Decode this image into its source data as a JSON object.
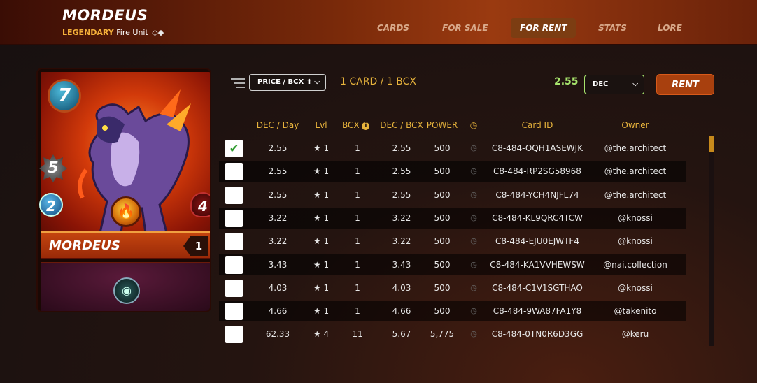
{
  "header": {
    "title": "MORDEUS",
    "rarity": "LEGENDARY",
    "unit_type": "Fire Unit",
    "nav": [
      "CARDS",
      "FOR SALE",
      "FOR RENT",
      "STATS",
      "LORE"
    ],
    "active_tab": "FOR RENT"
  },
  "card": {
    "name": "MORDEUS",
    "mana": "7",
    "attack": "5",
    "speed": "2",
    "health": "4",
    "level": "1",
    "element": "fire-icon",
    "ability": "eye-icon"
  },
  "toolbar": {
    "sort_label": "PRICE / BCX ⬆",
    "selection_text": "1 CARD / 1 BCX",
    "price": "2.55",
    "currency": "DEC",
    "rent_label": "RENT"
  },
  "table": {
    "headers": [
      "DEC / Day",
      "Lvl",
      "BCX",
      "DEC / BCX",
      "POWER",
      "Card ID",
      "Owner"
    ],
    "rows": [
      {
        "checked": true,
        "dec_day": "2.55",
        "lvl": "★ 1",
        "bcx": "1",
        "dec_bcx": "2.55",
        "power": "500",
        "card_id": "C8-484-OQH1ASEWJK",
        "owner": "@the.architect"
      },
      {
        "checked": false,
        "dec_day": "2.55",
        "lvl": "★ 1",
        "bcx": "1",
        "dec_bcx": "2.55",
        "power": "500",
        "card_id": "C8-484-RP2SG58968",
        "owner": "@the.architect"
      },
      {
        "checked": false,
        "dec_day": "2.55",
        "lvl": "★ 1",
        "bcx": "1",
        "dec_bcx": "2.55",
        "power": "500",
        "card_id": "C8-484-YCH4NJFL74",
        "owner": "@the.architect"
      },
      {
        "checked": false,
        "dec_day": "3.22",
        "lvl": "★ 1",
        "bcx": "1",
        "dec_bcx": "3.22",
        "power": "500",
        "card_id": "C8-484-KL9QRC4TCW",
        "owner": "@knossi"
      },
      {
        "checked": false,
        "dec_day": "3.22",
        "lvl": "★ 1",
        "bcx": "1",
        "dec_bcx": "3.22",
        "power": "500",
        "card_id": "C8-484-EJU0EJWTF4",
        "owner": "@knossi"
      },
      {
        "checked": false,
        "dec_day": "3.43",
        "lvl": "★ 1",
        "bcx": "1",
        "dec_bcx": "3.43",
        "power": "500",
        "card_id": "C8-484-KA1VVHEWSW",
        "owner": "@nai.collection"
      },
      {
        "checked": false,
        "dec_day": "4.03",
        "lvl": "★ 1",
        "bcx": "1",
        "dec_bcx": "4.03",
        "power": "500",
        "card_id": "C8-484-C1V1SGTHAO",
        "owner": "@knossi"
      },
      {
        "checked": false,
        "dec_day": "4.66",
        "lvl": "★ 1",
        "bcx": "1",
        "dec_bcx": "4.66",
        "power": "500",
        "card_id": "C8-484-9WA87FA1Y8",
        "owner": "@takenito"
      },
      {
        "checked": false,
        "dec_day": "62.33",
        "lvl": "★ 4",
        "bcx": "11",
        "dec_bcx": "5.67",
        "power": "5,775",
        "card_id": "C8-484-0TN0R6D3GG",
        "owner": "@keru"
      }
    ]
  },
  "colors": {
    "accent_gold": "#e7b33c",
    "price_green": "#a6e36c",
    "rent_orange": "#a8400e",
    "active_tab_bg": "#7c3d12"
  }
}
